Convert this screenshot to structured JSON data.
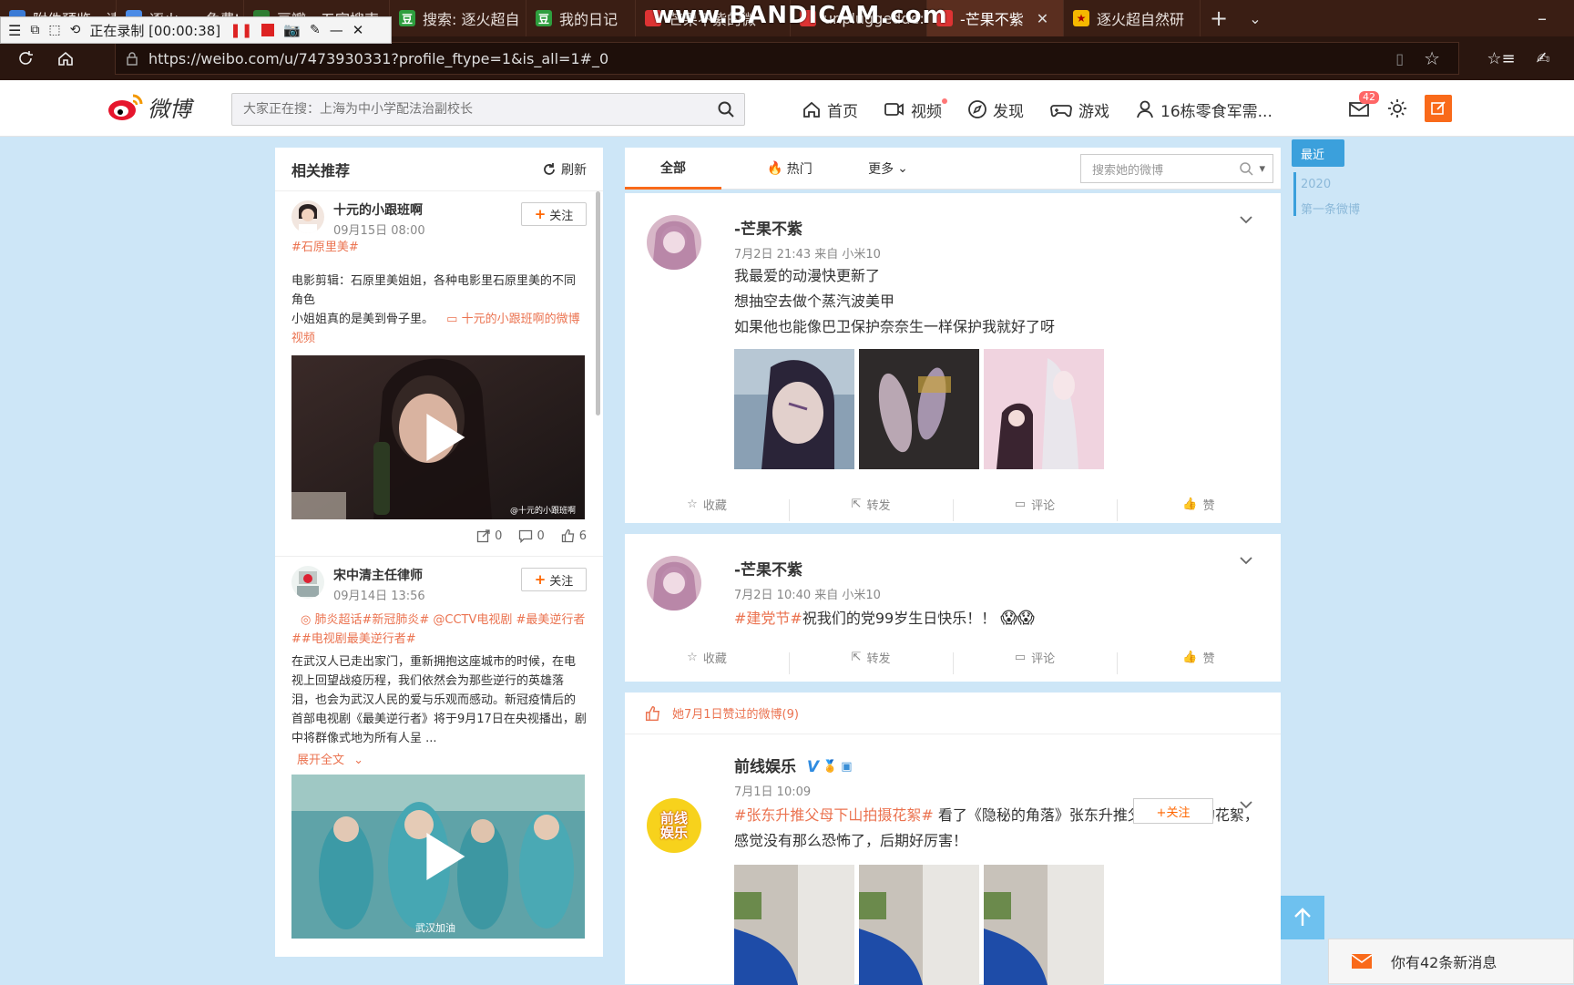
{
  "browser": {
    "tabs": [
      {
        "label": "附件预览 - 请",
        "icon_color": "#3b7bd6"
      },
      {
        "label": "逐火 ao 免费J",
        "icon_color": "#4b8be6"
      },
      {
        "label": "豆瓣 - 五官搜索",
        "icon_color": "#2e7d32"
      },
      {
        "label": "搜索: 逐火超自",
        "icon_color": "#2e9e3e",
        "icon_text": "豆"
      },
      {
        "label": "我的日记",
        "icon_color": "#2e9e3e",
        "icon_text": "豆"
      },
      {
        "label": "芒果不紫的微",
        "icon_color": "#d33"
      },
      {
        "label": "unpluggedde:",
        "icon_color": "#d33"
      },
      {
        "label": "-芒果不紫",
        "icon_color": "#d33"
      },
      {
        "label": "逐火超自然研",
        "icon_color": "#f5b800"
      }
    ],
    "recording_label": "正在录制 [00:00:38]",
    "watermark": "www.BANDICAM.com",
    "url": "https://weibo.com/u/7473930331?profile_ftype=1&is_all=1#_0"
  },
  "header": {
    "logo_text": "微博",
    "search_placeholder": "大家正在搜：上海为中小学配法治副校长",
    "nav": [
      {
        "label": "首页",
        "icon": "home-icon"
      },
      {
        "label": "视频",
        "icon": "video-icon"
      },
      {
        "label": "发现",
        "icon": "compass-icon"
      },
      {
        "label": "游戏",
        "icon": "gamepad-icon"
      },
      {
        "label": "16栋零食军需...",
        "icon": "user-icon"
      }
    ],
    "mail_badge": "42"
  },
  "recommend": {
    "title": "相关推荐",
    "refresh_label": "刷新",
    "follow_label": "关注",
    "items": [
      {
        "name": "十元的小跟班啊",
        "time": "09月15日 08:00",
        "tag": "#石原里美#",
        "text1": "电影剪辑：石原里美姐姐，各种电影里石原里美的不同角色",
        "text2": "小姐姐真的是美到骨子里。",
        "link": "十元的小跟班啊的微博视频",
        "video_watermark": "@十元的小跟班啊",
        "stats": {
          "forward": "0",
          "comment": "0",
          "like": "6"
        }
      },
      {
        "name": "宋中清主任律师",
        "time": "09月14日 13:56",
        "tag": "肺炎超话#新冠肺炎# @CCTV电视剧 #最美逆行者##电视剧最美逆行者#",
        "text1": "在武汉人已走出家门，重新拥抱这座城市的时候，在电视上回望战疫历程，我们依然会为那些逆行的英雄落泪，也会为武汉人民的爱与乐观而感动。新冠疫情后的首部电视剧《最美逆行者》将于9月17日在央视播出，剧中将群像式地为所有人呈 ...",
        "expand": "展开全文",
        "video_caption": "武汉加油"
      }
    ]
  },
  "feed": {
    "tabs": [
      "全部",
      "热门",
      "更多"
    ],
    "search_placeholder": "搜索她的微博",
    "actions": {
      "favorite": "收藏",
      "forward": "转发",
      "comment": "评论",
      "like": "赞"
    },
    "posts": [
      {
        "name": "-芒果不紫",
        "meta": "7月2日 21:43 来自 小米10",
        "lines": [
          "我最爱的动漫快更新了",
          "想抽空去做个蒸汽波美甲",
          "如果他也能像巴卫保护奈奈生一样保护我就好了呀"
        ]
      },
      {
        "name": "-芒果不紫",
        "meta": "7月2日 10:40 来自 小米10",
        "tag": "#建党节#",
        "text": "祝我们的党99岁生日快乐！！"
      }
    ],
    "liked_header": "她7月1日赞过的微博(9)",
    "liked_post": {
      "name": "前线娱乐",
      "avatar_text": "前线娱乐",
      "meta": "7月1日 10:09",
      "tag": "#张东升推父母下山拍摄花絮#",
      "text": " 看了《隐秘的角落》张东升推父母这一段的花絮，感觉没有那么恐怖了，后期好厉害！",
      "follow_label": "+关注"
    }
  },
  "timeline": {
    "current": "最近",
    "year": "2020",
    "first": "第一条微博"
  },
  "toast": "你有42条新消息",
  "colors": {
    "accent": "#eb7350",
    "brand_orange": "#f96a1a",
    "page_bg": "#cde6f7",
    "timeline_blue": "#3ba0dc"
  }
}
